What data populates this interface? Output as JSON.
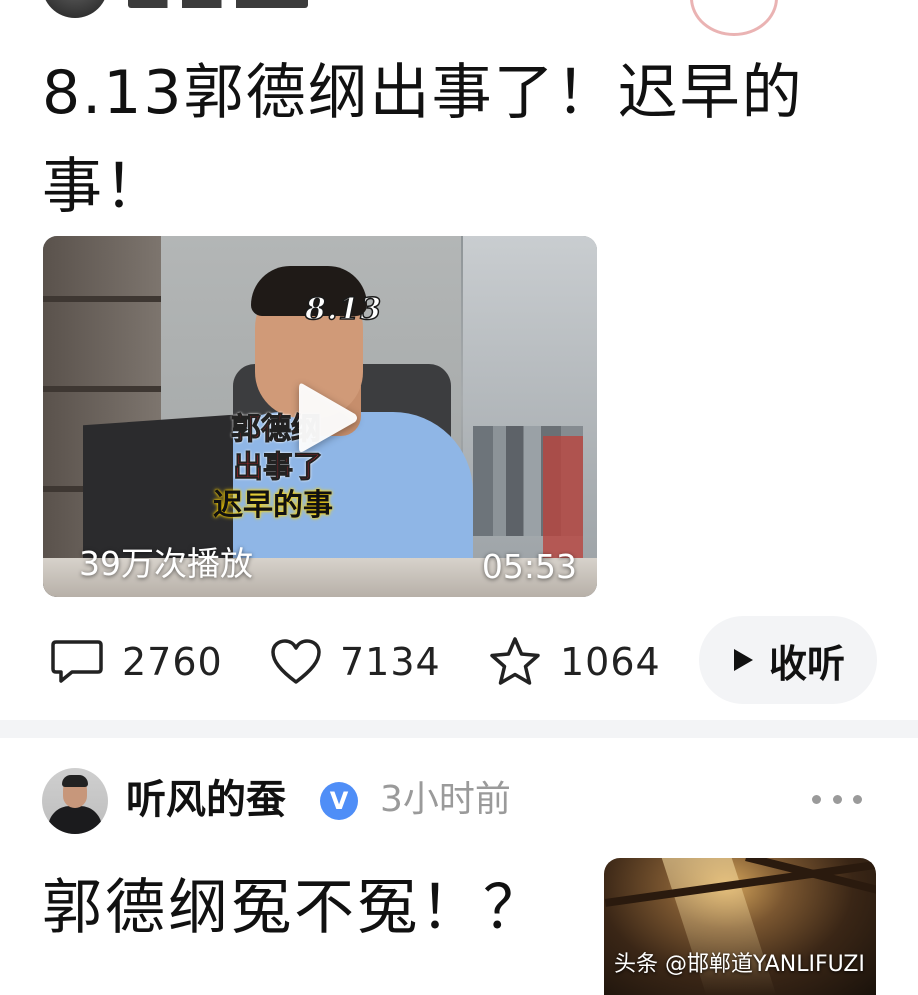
{
  "post1": {
    "title": "8.13郭德纲出事了！迟早的事！",
    "video": {
      "overlay_tag": "8.13",
      "caption_line1": "郭德纲",
      "caption_line2": "出事了",
      "caption_line3": "迟早的事",
      "views": "39万次播放",
      "duration": "05:53",
      "play_icon": "play-icon"
    },
    "actions": {
      "comments": "2760",
      "likes": "7134",
      "favorites": "1064",
      "listen_label": "收听"
    }
  },
  "post2": {
    "author": "听风的蚕",
    "verified_badge": "V",
    "time": "3小时前",
    "title": "郭德纲冤不冤！？",
    "watermark": "头条 @邯郸道YANLIFUZI"
  },
  "colors": {
    "verified_blue": "#4f8ef7",
    "listen_bg": "#f3f4f6",
    "muted_text": "#9a9a9a"
  },
  "icons": [
    "comment-icon",
    "heart-icon",
    "star-icon",
    "play-icon",
    "more-icon",
    "verified-icon"
  ]
}
